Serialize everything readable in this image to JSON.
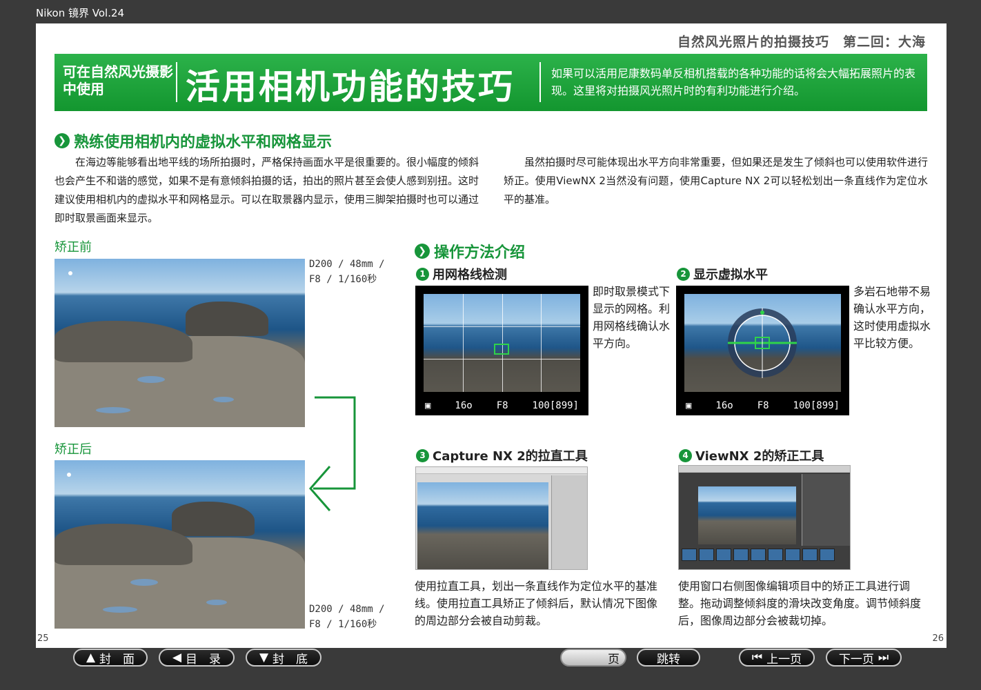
{
  "window": {
    "title": "Nikon 镜界 Vol.24"
  },
  "header": {
    "series": "自然风光照片的拍摄技巧　第二回：大海"
  },
  "banner": {
    "subtitle": "可在自然风光摄影中使用",
    "title": "活用相机功能的技巧",
    "description": "如果可以活用尼康数码单反相机搭载的各种功能的话将会大幅拓展照片的表现。这里将对拍摄风光照片时的有利功能进行介绍。"
  },
  "section1": {
    "heading": "熟练使用相机内的虚拟水平和网格显示",
    "para_left": "在海边等能够看出地平线的场所拍摄时，严格保持画面水平是很重要的。很小幅度的倾斜也会产生不和谐的感觉，如果不是有意倾斜拍摄的话，拍出的照片甚至会使人感到别扭。这时建议使用相机内的虚拟水平和网格显示。可以在取景器内显示，使用三脚架拍摄时也可以通过即时取景画面来显示。",
    "para_right": "虽然拍摄时尽可能体现出水平方向非常重要，但如果还是发生了倾斜也可以使用软件进行矫正。使用ViewNX 2当然没有问题，使用Capture NX 2可以轻松划出一条直线作为定位水平的基准。"
  },
  "before": {
    "label": "矫正前",
    "caption": "D200 / 48mm /\nF8 / 1/160秒"
  },
  "after": {
    "label": "矫正后",
    "caption": "D200 / 48mm /\nF8 / 1/160秒"
  },
  "section2": {
    "heading": "操作方法介绍"
  },
  "steps": [
    {
      "num": "1",
      "title": "用网格线检测",
      "text": "即时取景模式下显示的网格。利用网格线确认水平方向。"
    },
    {
      "num": "2",
      "title": "显示虚拟水平",
      "text": "多岩石地带不易确认水平方向，这时使用虚拟水平比较方便。"
    },
    {
      "num": "3",
      "title": "Capture NX 2的拉直工具",
      "text": "使用拉直工具，划出一条直线作为定位水平的基准线。使用拉直工具矫正了倾斜后，默认情况下图像的周边部分会被自动剪裁。"
    },
    {
      "num": "4",
      "title": "ViewNX 2的矫正工具",
      "text": "使用窗口右侧图像编辑项目中的矫正工具进行调整。拖动调整倾斜度的滑块改变角度。调节倾斜度后，图像周边部分会被裁切掉。"
    }
  ],
  "lcd": {
    "iso": "16o",
    "aperture": "F8",
    "shots": "100[899]"
  },
  "pages": {
    "left": "25",
    "right": "26"
  },
  "nav": {
    "cover": "封　面",
    "toc": "目　录",
    "back_cover": "封　底",
    "page": "页",
    "jump": "跳转",
    "prev": "上一页",
    "next": "下一页"
  },
  "colors": {
    "brand_green": "#17953a",
    "banner_green": "#2cb24a"
  }
}
